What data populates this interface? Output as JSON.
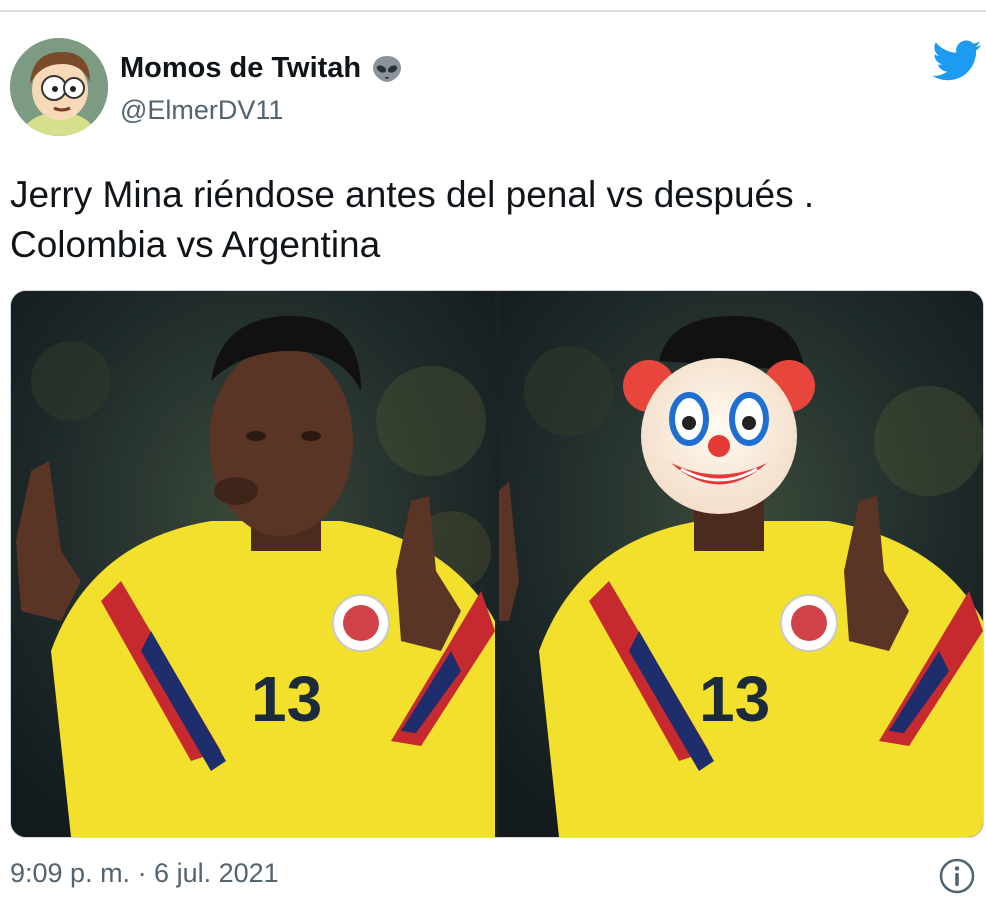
{
  "author": {
    "name": "Momos de Twitah",
    "handle": "@ElmerDV11",
    "badge_icon": "alien-emoji",
    "avatar": "cartoon-avatar"
  },
  "brand": {
    "icon": "twitter-bird-icon",
    "color": "#1d9bf0"
  },
  "tweet": {
    "text_line1": "Jerry Mina riéndose antes del penal vs después .",
    "text_line2": "Colombia vs Argentina"
  },
  "media": {
    "left_image": "player-pointing-photo",
    "right_image": "player-pointing-photo-clown-face",
    "right_overlay_icon": "clown-face-emoji",
    "jersey_number": "13"
  },
  "footer": {
    "timestamp": "9:09 p. m. · 6 jul. 2021",
    "info_icon": "info-icon"
  }
}
